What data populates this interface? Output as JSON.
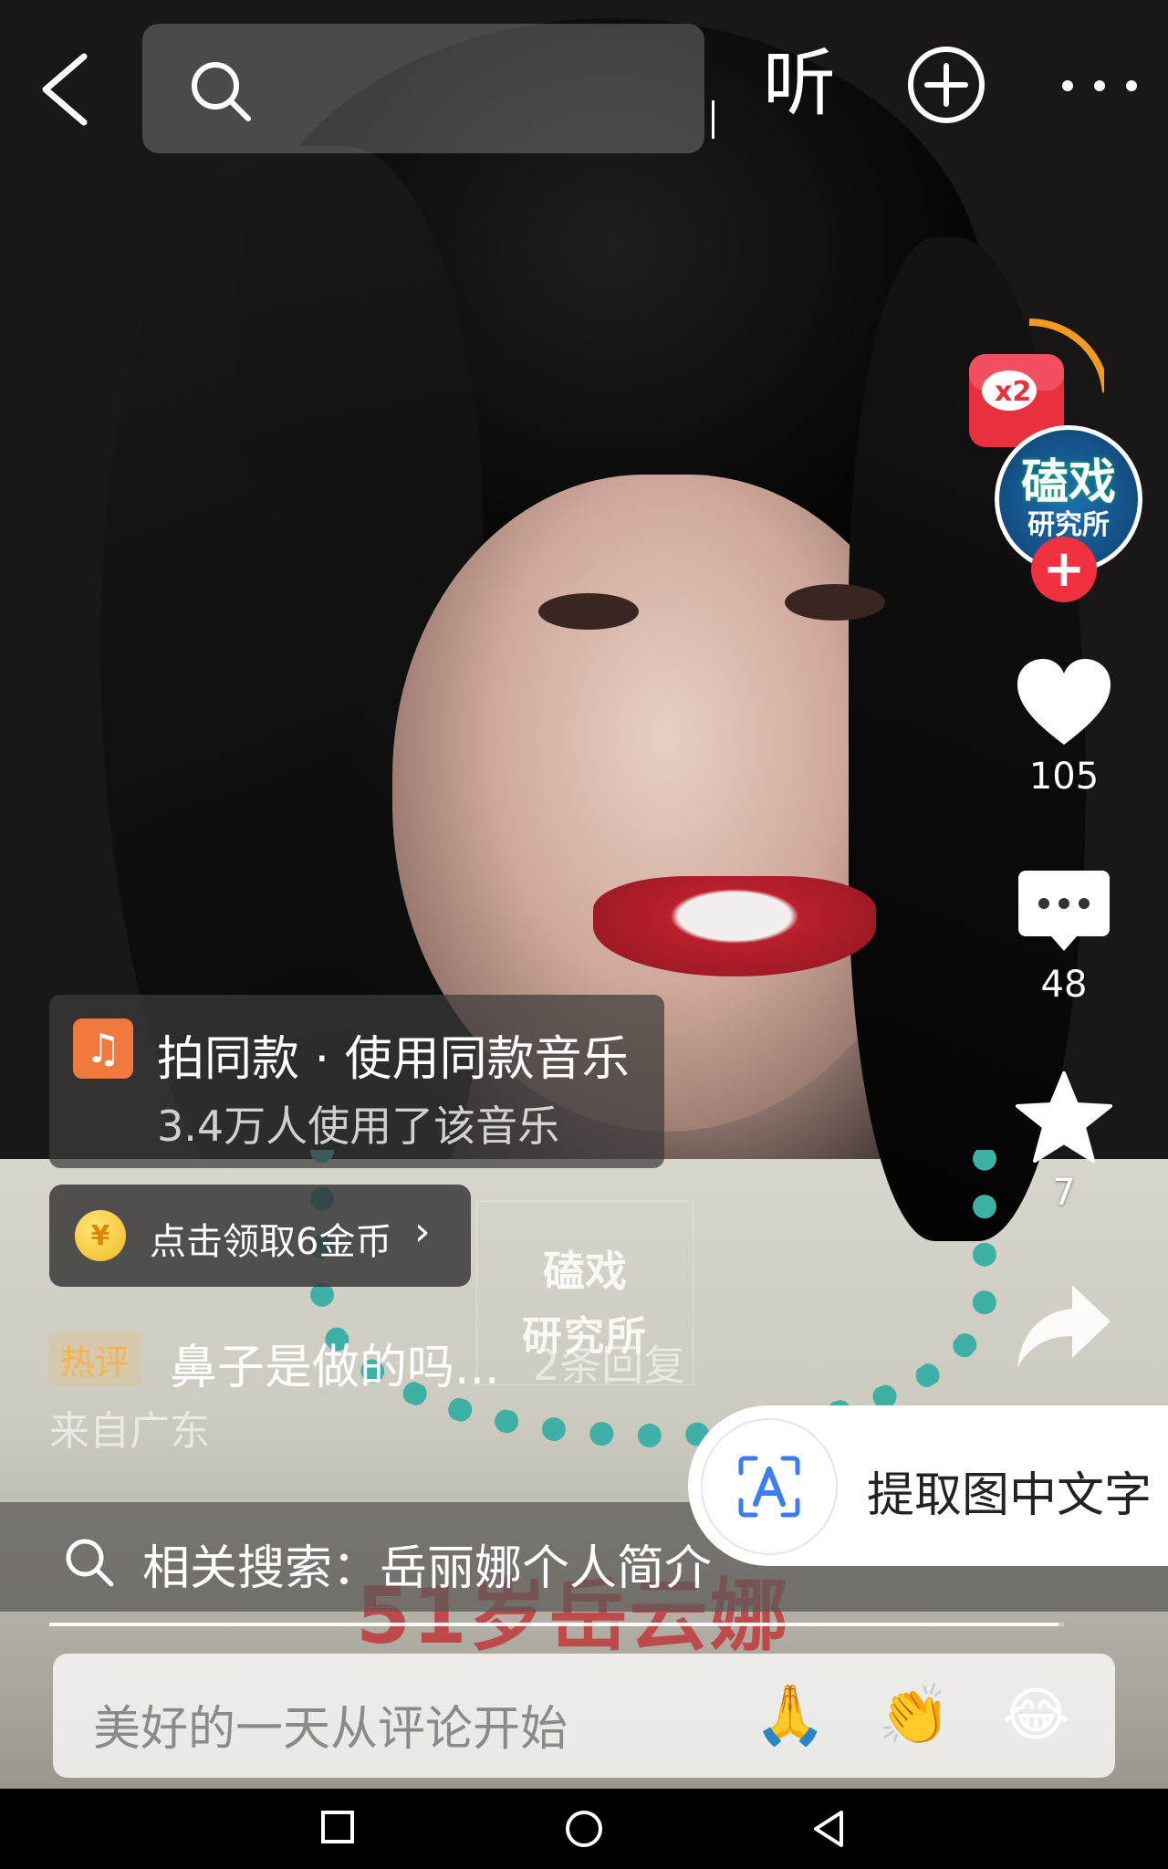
{
  "top_bar": {
    "back_icon": "chevron-left-icon",
    "search": {
      "icon": "search-icon",
      "value": ""
    },
    "listen_label": "听",
    "add_icon": "plus-circle-icon",
    "more_icon": "more-horizontal-icon"
  },
  "video": {
    "watermark_line1": "磕",
    "watermark_line1b": "戏",
    "watermark_line2": "研究所",
    "caption": "51岁岳云娜"
  },
  "right_rail": {
    "red_packet_badge": "x2",
    "avatar": {
      "line1": "磕戏",
      "line2": "研究所"
    },
    "follow_symbol": "+",
    "likes": "105",
    "comments": "48",
    "favorites": "7"
  },
  "music_card": {
    "title": "拍同款 · 使用同款音乐",
    "subtitle": "3.4万人使用了该音乐"
  },
  "coin_button": {
    "coin_symbol": "¥",
    "label": "点击领取6金币",
    "chevron": "›"
  },
  "hot_comment": {
    "tag": "热评",
    "text": "鼻子是做的吗...",
    "replies": "2条回复",
    "location": "来自广东"
  },
  "ocr_popup": {
    "label": "提取图中文字"
  },
  "related_search": {
    "label": "相关搜索：岳丽娜个人简介"
  },
  "progress": {
    "fraction": 0.995
  },
  "comment_input": {
    "placeholder": "美好的一天从评论开始",
    "emojis": [
      "🙏",
      "👏",
      "😂"
    ]
  },
  "colors": {
    "follow_red": "#f0313f",
    "music_orange": "#f07a3e",
    "hot_tag": "#f5b34a",
    "ocr_blue": "#3d7cf0"
  }
}
